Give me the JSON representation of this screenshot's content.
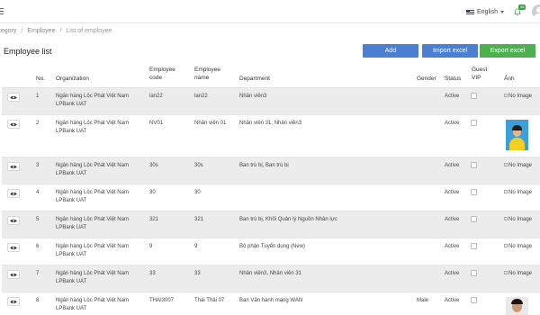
{
  "topbar": {
    "language": "English",
    "notification_count": "45"
  },
  "breadcrumb": {
    "items": [
      "ategory",
      "Employee",
      "List of employee"
    ]
  },
  "page": {
    "title": "Employee list",
    "buttons": {
      "add": "Add",
      "import": "Import excel",
      "export": "Export excel"
    }
  },
  "table": {
    "headers": {
      "no": "No.",
      "organization": "Organization",
      "code": "Employee code",
      "name": "Employee name",
      "department": "Department",
      "gender": "Gender",
      "status": "Status",
      "guest_vip": "Guest VIP",
      "image": "Ảnh"
    },
    "no_image_text": "No Image",
    "rows": [
      {
        "no": "1",
        "org": "Ngân hàng Lộc Phát Việt Nam LPBank UAT",
        "code": "lan22",
        "name": "lan22",
        "department": "Nhân viên3",
        "gender": "",
        "status": "Active"
      },
      {
        "no": "2",
        "org": "Ngân hàng Lộc Phát Việt Nam LPBank UAT",
        "code": "NV01",
        "name": "Nhân viên 01",
        "department": "Nhân viên 31, Nhân viên3",
        "gender": "",
        "status": "Active"
      },
      {
        "no": "3",
        "org": "Ngân hàng Lộc Phát Việt Nam LPBank UAT",
        "code": "30s",
        "name": "30s",
        "department": "Ban trù bị, Ban trù bị",
        "gender": "",
        "status": "Active"
      },
      {
        "no": "4",
        "org": "Ngân hàng Lộc Phát Việt Nam LPBank UAT",
        "code": "30",
        "name": "30",
        "department": "",
        "gender": "",
        "status": "Active"
      },
      {
        "no": "5",
        "org": "Ngân hàng Lộc Phát Việt Nam LPBank UAT",
        "code": "321",
        "name": "321",
        "department": "Ban trù bị, Khối Quản lý Nguồn Nhân lực",
        "gender": "",
        "status": "Active"
      },
      {
        "no": "6",
        "org": "Ngân hàng Lộc Phát Việt Nam LPBank UAT",
        "code": "9",
        "name": "9",
        "department": "Bộ phận Tuyển dụng (New)",
        "gender": "",
        "status": "Active"
      },
      {
        "no": "7",
        "org": "Ngân hàng Lộc Phát Việt Nam LPBank UAT",
        "code": "33",
        "name": "33",
        "department": "Nhân viên3, Nhân viên 31",
        "gender": "",
        "status": "Active"
      },
      {
        "no": "8",
        "org": "Ngân hàng Lộc Phát Việt Nam LPBank UAT",
        "code": "THAI3007",
        "name": "Thái Thái 07",
        "department": "Ban Vận hành mạng WAN",
        "gender": "Male",
        "status": "Active"
      }
    ]
  }
}
